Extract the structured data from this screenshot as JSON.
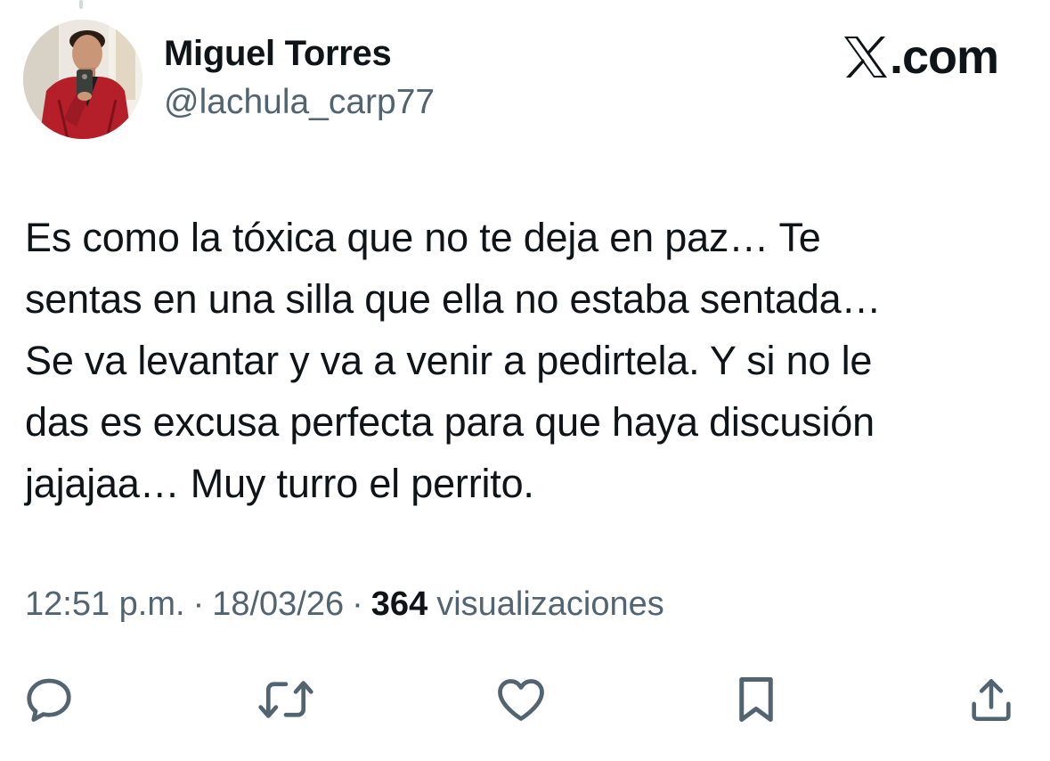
{
  "post": {
    "author_name": "Miguel Torres",
    "author_handle": "@lachula_carp77",
    "brand_label": ".com",
    "brand_icon": "x-logo-icon",
    "text": "Es como la tóxica que no te deja en paz… Te\nsentas en una silla que ella no estaba sentada…\nSe va levantar y va a venir a pedirtela. Y si no le\ndas es excusa perfecta para que haya discusión\njajajaa… Muy turro el perrito.",
    "time": "12:51 p.m.",
    "separator": "·",
    "date": "18/03/26",
    "views_count": "364",
    "views_label": "visualizaciones"
  },
  "actions": [
    {
      "name": "reply",
      "icon": "reply-icon"
    },
    {
      "name": "repost",
      "icon": "repost-icon"
    },
    {
      "name": "like",
      "icon": "heart-icon"
    },
    {
      "name": "bookmark",
      "icon": "bookmark-icon"
    },
    {
      "name": "share",
      "icon": "share-icon"
    }
  ],
  "colors": {
    "text": "#0f1419",
    "secondary": "#536471",
    "icon": "#536471",
    "thread_line": "#cfd9de"
  }
}
